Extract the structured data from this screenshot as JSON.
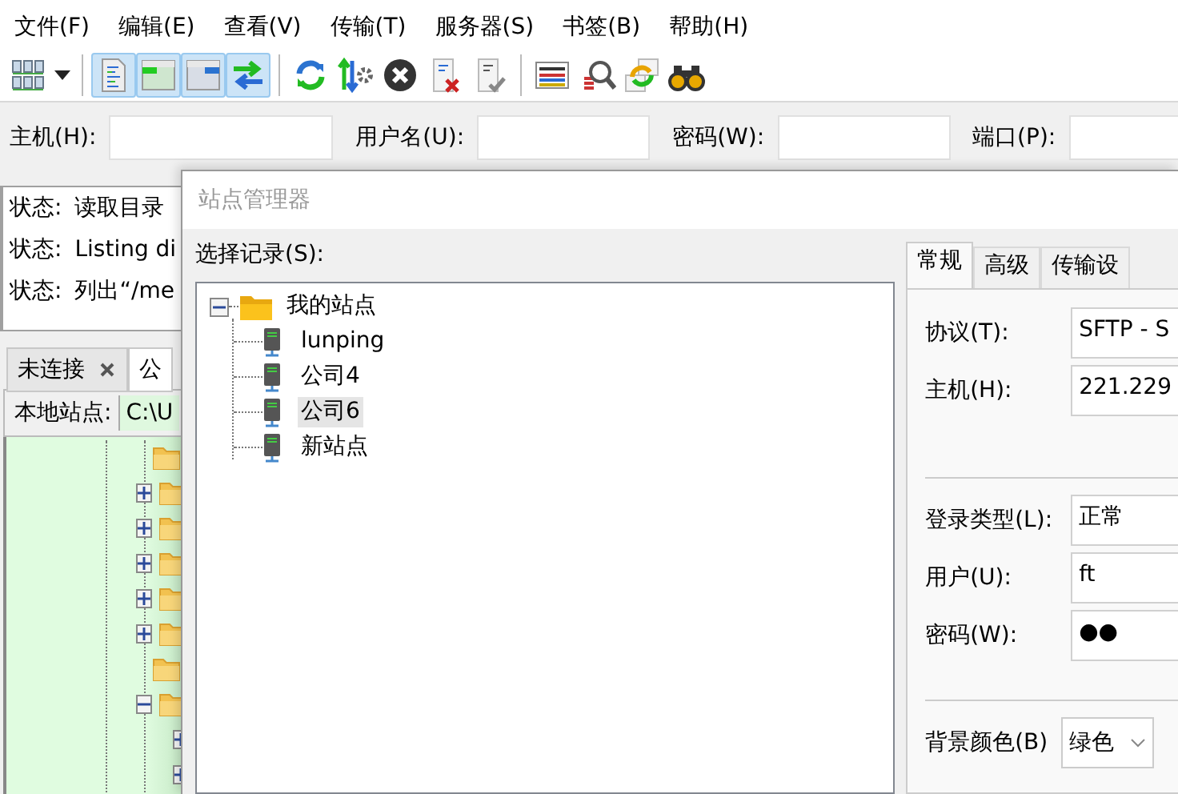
{
  "menu": [
    "文件(F)",
    "编辑(E)",
    "查看(V)",
    "传输(T)",
    "服务器(S)",
    "书签(B)",
    "帮助(H)"
  ],
  "toolbar": [
    {
      "kind": "sites",
      "pressed": false
    },
    {
      "kind": "caret",
      "pressed": false
    },
    {
      "kind": "sep"
    },
    {
      "kind": "log",
      "pressed": true
    },
    {
      "kind": "local",
      "pressed": true
    },
    {
      "kind": "remote",
      "pressed": true
    },
    {
      "kind": "queue",
      "pressed": true
    },
    {
      "kind": "sep"
    },
    {
      "kind": "refresh",
      "pressed": false
    },
    {
      "kind": "process",
      "pressed": false
    },
    {
      "kind": "cancel",
      "pressed": false
    },
    {
      "kind": "disconnect",
      "pressed": false
    },
    {
      "kind": "reconnect",
      "pressed": false
    },
    {
      "kind": "sep"
    },
    {
      "kind": "filter",
      "pressed": false
    },
    {
      "kind": "search",
      "pressed": false
    },
    {
      "kind": "sync",
      "pressed": false
    },
    {
      "kind": "find",
      "pressed": false
    }
  ],
  "quickconnect": [
    {
      "label": "主机(H):"
    },
    {
      "label": "用户名(U):"
    },
    {
      "label": "密码(W):"
    },
    {
      "label": "端口(P):"
    }
  ],
  "message_log": [
    {
      "label": "状态:",
      "text": "读取目录"
    },
    {
      "label": "状态:",
      "text": "Listing di"
    },
    {
      "label": "状态:",
      "text": "列出“/me"
    }
  ],
  "tabs": [
    {
      "label": "未连接",
      "selected": false,
      "closable": true
    },
    {
      "label": "公",
      "selected": true,
      "closable": false
    }
  ],
  "local_site": {
    "label": "本地站点:",
    "path": "C:\\U"
  },
  "local_tree": [
    {
      "kind": "leaf"
    },
    {
      "kind": "branch",
      "expanded": false
    },
    {
      "kind": "branch",
      "expanded": false
    },
    {
      "kind": "branch",
      "expanded": false
    },
    {
      "kind": "branch",
      "expanded": false
    },
    {
      "kind": "branch",
      "expanded": false
    },
    {
      "kind": "leaf"
    },
    {
      "kind": "branch",
      "expanded": true,
      "children": [
        {
          "kind": "branch",
          "expanded": false
        },
        {
          "kind": "branch",
          "expanded": false
        }
      ]
    }
  ],
  "site_manager": {
    "title": "站点管理器",
    "select_label": "选择记录(S):",
    "tree": {
      "label": "我的站点",
      "expanded": true,
      "children": [
        {
          "label": "lunping",
          "selected": false
        },
        {
          "label": "公司4",
          "selected": false
        },
        {
          "label": "公司6",
          "selected": true
        },
        {
          "label": "新站点",
          "selected": false
        }
      ]
    },
    "tabs": [
      {
        "label": "常规",
        "selected": true
      },
      {
        "label": "高级",
        "selected": false
      },
      {
        "label": "传输设",
        "selected": false
      }
    ],
    "groups": [
      [
        {
          "kind": "select",
          "label": "协议(T):",
          "value": "SFTP - S"
        },
        {
          "kind": "input",
          "label": "主机(H):",
          "value": "221.229"
        }
      ],
      [
        {
          "kind": "select",
          "label": "登录类型(L):",
          "value": "正常"
        },
        {
          "kind": "input",
          "label": "用户(U):",
          "value": "ft"
        },
        {
          "kind": "input",
          "label": "密码(W):",
          "value": "●●"
        }
      ],
      [
        {
          "kind": "dropdown",
          "label": "背景颜色(B)",
          "value": "绿色"
        }
      ]
    ]
  }
}
